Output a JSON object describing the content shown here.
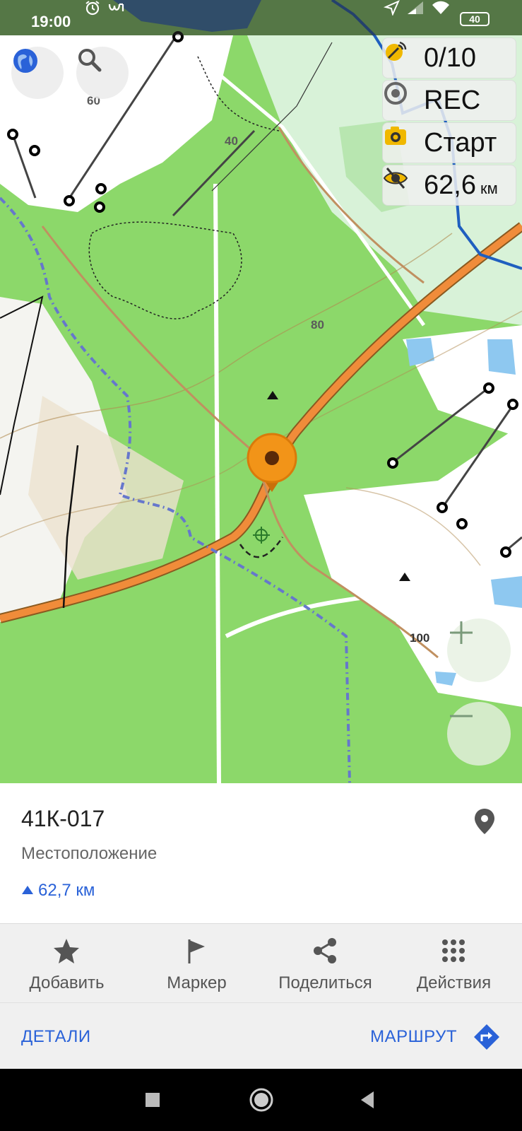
{
  "status_bar": {
    "time": "19:00",
    "battery": "40"
  },
  "map": {
    "contour_labels": [
      "60",
      "40",
      "80",
      "100"
    ]
  },
  "overlay": {
    "waypoints": "0/10",
    "record": "REC",
    "camera": "Старт",
    "distance_value": "62,6",
    "distance_unit": "км"
  },
  "location_card": {
    "title": "41К-017",
    "subtitle": "Местоположение",
    "elevation": "62,7 км"
  },
  "actions": [
    {
      "label": "Добавить",
      "icon": "star-icon"
    },
    {
      "label": "Маркер",
      "icon": "flag-icon"
    },
    {
      "label": "Поделиться",
      "icon": "share-icon"
    },
    {
      "label": "Действия",
      "icon": "grid-dots-icon"
    }
  ],
  "footer": {
    "details_label": "ДЕТАЛИ",
    "route_label": "МАРШРУТ"
  },
  "colors": {
    "accent": "#2a62d8",
    "pin_orange": "#f29418",
    "forest": "#8cd86a",
    "road_orange": "#f08c3a"
  }
}
